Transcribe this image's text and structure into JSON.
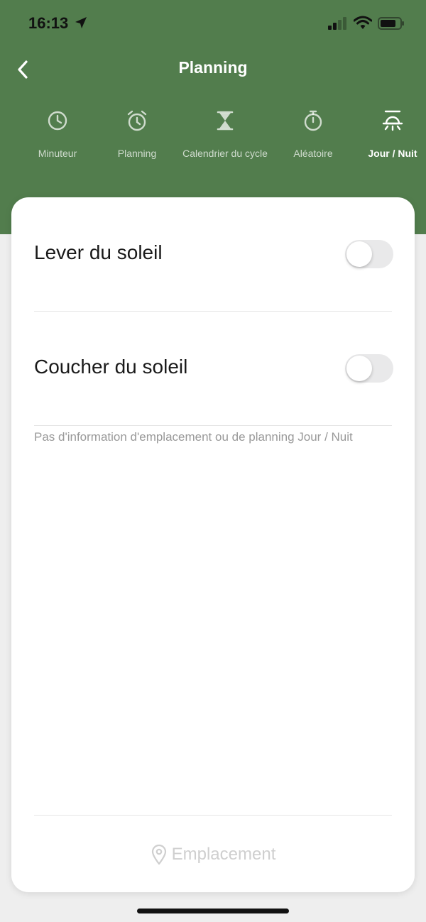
{
  "status_bar": {
    "time": "16:13"
  },
  "nav": {
    "title": "Planning"
  },
  "tabs": [
    {
      "label": "Minuteur",
      "icon": "clock-icon",
      "active": false
    },
    {
      "label": "Planning",
      "icon": "alarm-clock-icon",
      "active": false
    },
    {
      "label": "Calendrier du cycle",
      "icon": "hourglass-icon",
      "active": false
    },
    {
      "label": "Aléatoire",
      "icon": "stopwatch-icon",
      "active": false
    },
    {
      "label": "Jour / Nuit",
      "icon": "sun-icon",
      "active": true
    }
  ],
  "card": {
    "sunrise": {
      "label": "Lever du soleil",
      "enabled": false
    },
    "sunset": {
      "label": "Coucher du soleil",
      "enabled": false
    },
    "info": "Pas d'information d'emplacement ou de planning Jour / Nuit",
    "location_label": "Emplacement"
  },
  "colors": {
    "header": "#527d4d",
    "toggle_off": "#e9e9ea",
    "muted_text": "#999999",
    "disabled_text": "#cfcfcf"
  }
}
